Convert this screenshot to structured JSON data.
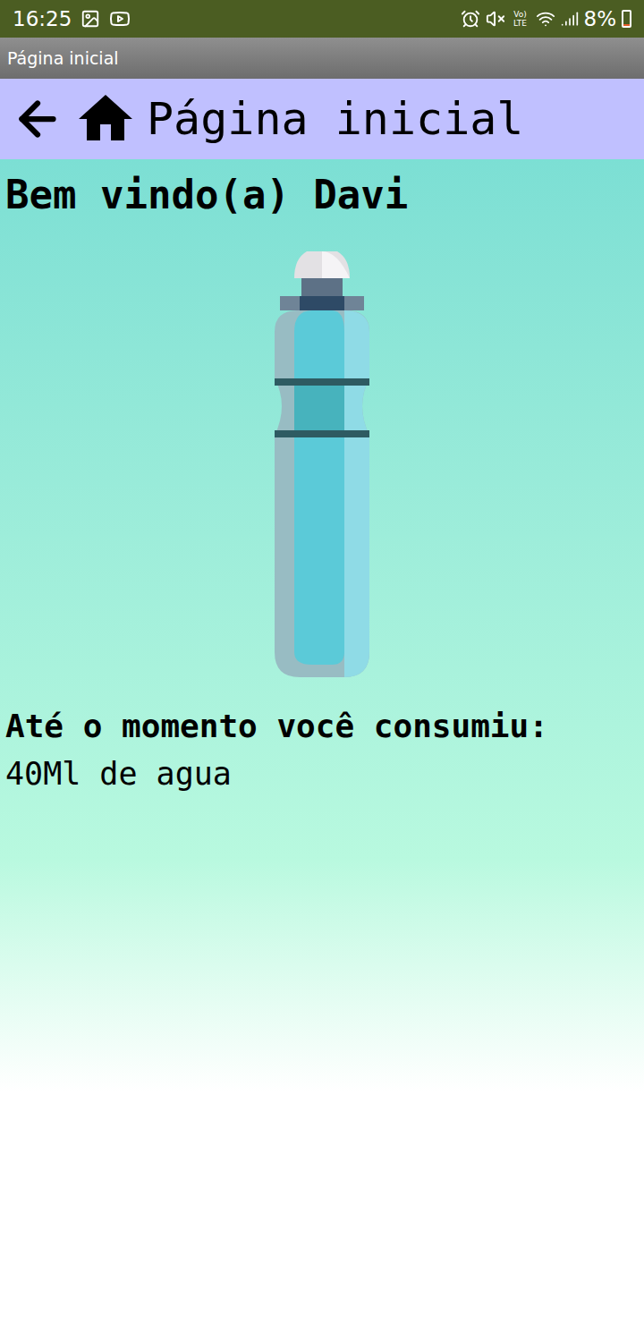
{
  "status_bar": {
    "time": "16:25",
    "volte": "Vo) LTE",
    "battery": "8%",
    "battery_level": 0.08
  },
  "window": {
    "title": "Página inicial"
  },
  "header": {
    "title": "Página inicial"
  },
  "greeting": "Bem vindo(a) Davi",
  "consumption": {
    "label": "Até o momento você consumiu:",
    "amount": "40Ml de agua"
  }
}
